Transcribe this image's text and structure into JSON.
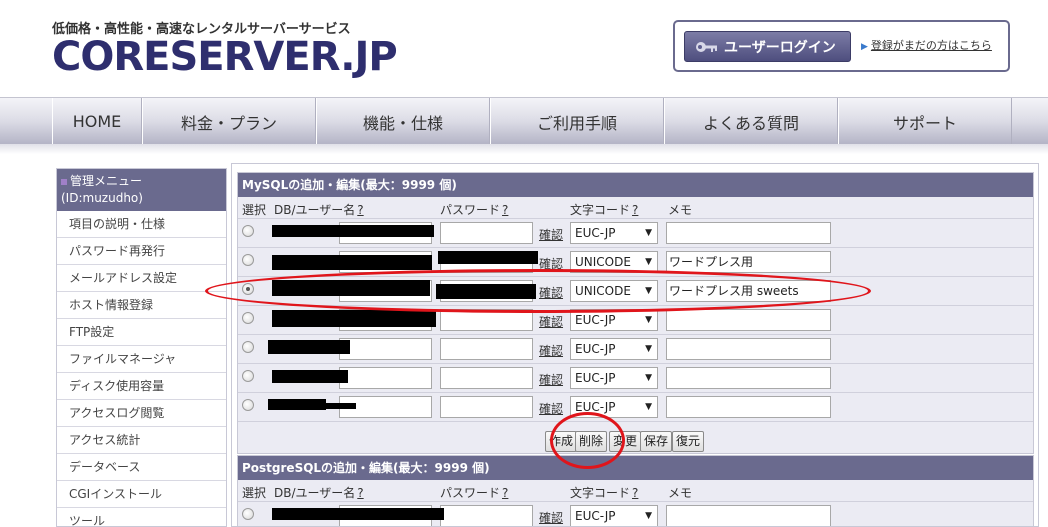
{
  "header": {
    "tagline": "低価格・高性能・高速なレンタルサーバーサービス",
    "logo": "CORESERVER.JP",
    "login_button": "ユーザーログイン",
    "signup_link": "登録がまだの方はこちら"
  },
  "nav": {
    "items": [
      "HOME",
      "料金・プラン",
      "機能・仕様",
      "ご利用手順",
      "よくある質問",
      "サポート"
    ]
  },
  "sidebar": {
    "title": "管理メニュー",
    "user": "(ID:muzudho)",
    "items": [
      "項目の説明・仕様",
      "パスワード再発行",
      "メールアドレス設定",
      "ホスト情報登録",
      "FTP設定",
      "ファイルマネージャ",
      "ディスク使用容量",
      "アクセスログ閲覧",
      "アクセス統計",
      "データベース",
      "CGIインストール",
      "ツール"
    ]
  },
  "mysql": {
    "title": "MySQLの追加・編集(最大：9999 個)",
    "columns": {
      "select": "選択",
      "db": "DB/ユーザー名",
      "password": "パスワード",
      "charset": "文字コード",
      "memo": "メモ",
      "help": "?"
    },
    "confirm_label": "確認",
    "rows": [
      {
        "charset": "EUC-JP",
        "memo": "",
        "checked": false
      },
      {
        "charset": "UNICODE",
        "memo": "ワードプレス用",
        "checked": false
      },
      {
        "charset": "UNICODE",
        "memo": "ワードプレス用 sweets",
        "checked": true
      },
      {
        "charset": "EUC-JP",
        "memo": "",
        "checked": false
      },
      {
        "charset": "EUC-JP",
        "memo": "",
        "checked": false
      },
      {
        "charset": "EUC-JP",
        "memo": "",
        "checked": false
      },
      {
        "charset": "EUC-JP",
        "memo": "",
        "checked": false
      }
    ],
    "buttons": {
      "create": "作成",
      "delete": "削除",
      "change": "変更",
      "save": "保存",
      "restore": "復元"
    }
  },
  "postgres": {
    "title": "PostgreSQLの追加・編集(最大：9999 個)",
    "columns": {
      "select": "選択",
      "db": "DB/ユーザー名",
      "password": "パスワード",
      "charset": "文字コード",
      "memo": "メモ",
      "help": "?"
    },
    "confirm_label": "確認",
    "rows": [
      {
        "charset": "EUC-JP",
        "memo": ""
      }
    ]
  },
  "colors": {
    "accent": "#6a6a8e",
    "annotation": "#e0151b"
  },
  "icons": {
    "login": "key-icon",
    "signup": "triangle-right-icon",
    "sidebar": "square-bullet-icon",
    "select": "chevron-down-icon"
  }
}
